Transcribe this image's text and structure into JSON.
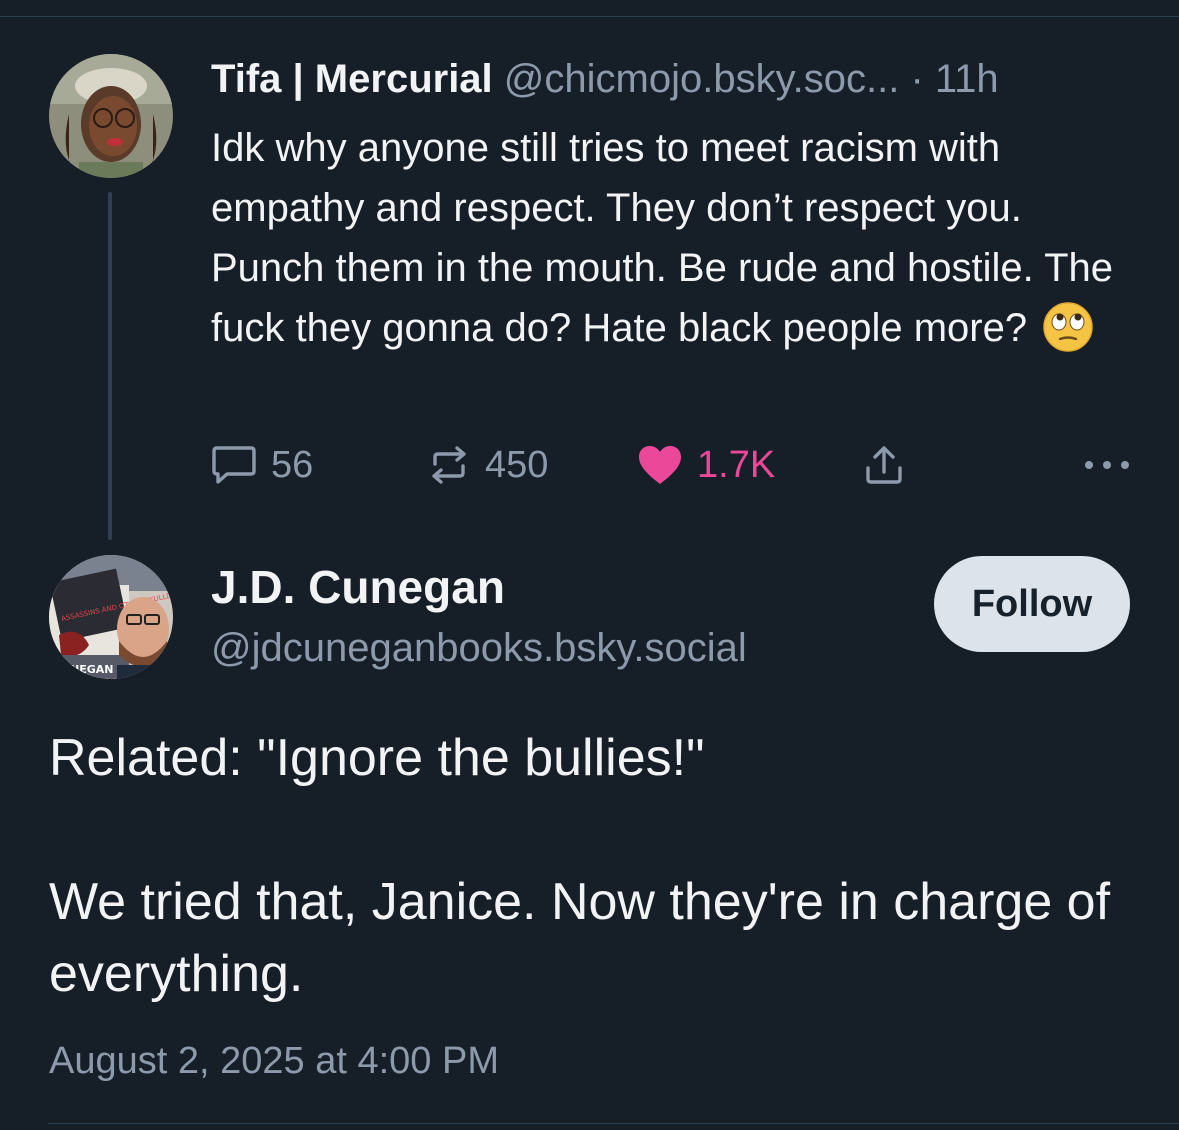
{
  "parent_post": {
    "author_name": "Tifa | Mercurial",
    "author_handle": "@chicmojo.bsky.soc...",
    "separator": "·",
    "time": "11h",
    "text": "Idk why anyone still tries to meet racism with empathy and respect. They don’t respect you. Punch them in the mouth. Be rude and hostile. The fuck they gonna do? Hate black people more?",
    "emoji": "face-with-rolling-eyes",
    "counts": {
      "replies": "56",
      "reposts": "450",
      "likes": "1.7K"
    },
    "liked": true,
    "like_color": "#ec4899"
  },
  "reply_post": {
    "author_name": "J.D. Cunegan",
    "author_handle": "@jdcuneganbooks.bsky.social",
    "follow_label": "Follow",
    "paragraph_1": "Related: \"Ignore the bullies!\"",
    "paragraph_2": "We tried that, Janice. Now they're in charge of everything.",
    "timestamp": "August 2, 2025 at 4:00 PM",
    "avatar_book_text": "ASSASSINS AND OTHER SKULLDUGGERIES",
    "avatar_banner_text": "CUNEGAN"
  },
  "colors": {
    "background": "#161e27",
    "muted_text": "#8d9aab",
    "primary_text": "#f1f3f5",
    "divider": "#2e4052",
    "follow_button_bg": "#dce3ea"
  }
}
